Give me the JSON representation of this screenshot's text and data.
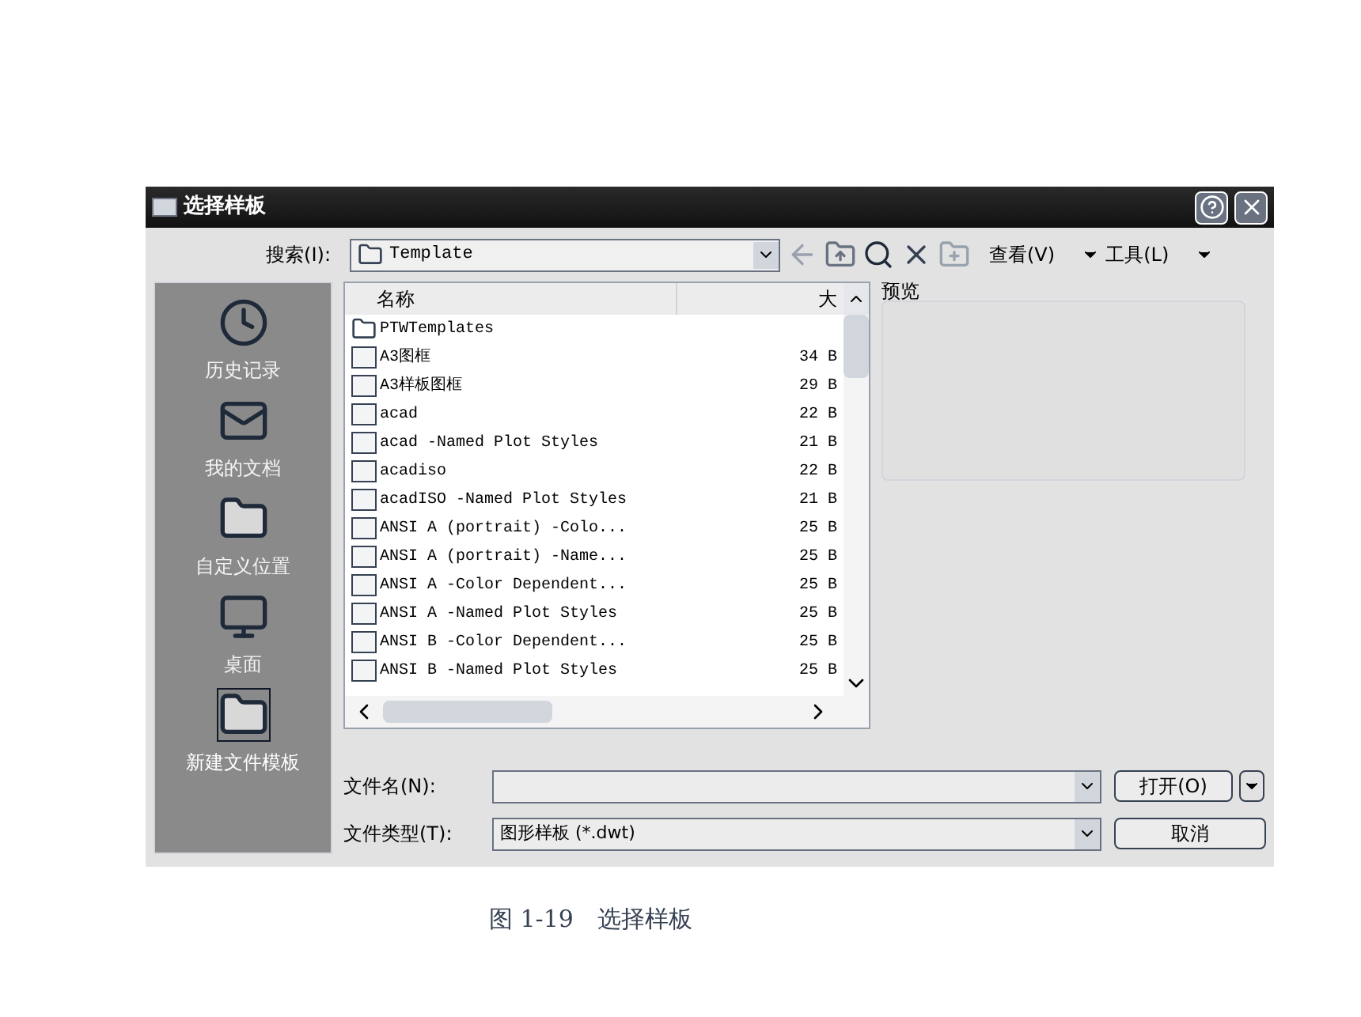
{
  "window": {
    "title": "选择样板"
  },
  "toolbar": {
    "search_label": "搜索(I):",
    "location": "Template",
    "view_menu": "查看(V)",
    "tools_menu": "工具(L)"
  },
  "sidebar": {
    "items": [
      {
        "label": "历史记录",
        "kind": "history",
        "selected": false
      },
      {
        "label": "我的文档",
        "kind": "documents",
        "selected": false
      },
      {
        "label": "自定义位置",
        "kind": "folder",
        "selected": false
      },
      {
        "label": "桌面",
        "kind": "desktop",
        "selected": false
      },
      {
        "label": "新建文件模板",
        "kind": "folder",
        "selected": true
      }
    ]
  },
  "file_list": {
    "columns": [
      "名称",
      "大"
    ],
    "rows": [
      {
        "name": "PTWTemplates",
        "kind": "folder",
        "size": ""
      },
      {
        "name": "A3图框",
        "kind": "dwt",
        "size": "34 B"
      },
      {
        "name": "A3样板图框",
        "kind": "dwt",
        "size": "29 B"
      },
      {
        "name": "acad",
        "kind": "dwt",
        "size": "22 B"
      },
      {
        "name": "acad -Named Plot Styles",
        "kind": "dwt",
        "size": "21 B"
      },
      {
        "name": "acadiso",
        "kind": "dwt",
        "size": "22 B"
      },
      {
        "name": "acadISO -Named Plot Styles",
        "kind": "dwt",
        "size": "21 B"
      },
      {
        "name": "ANSI A (portrait) -Colo...",
        "kind": "dwt",
        "size": "25 B"
      },
      {
        "name": "ANSI A (portrait) -Name...",
        "kind": "dwt",
        "size": "25 B"
      },
      {
        "name": "ANSI A -Color Dependent...",
        "kind": "dwt",
        "size": "25 B"
      },
      {
        "name": "ANSI A -Named Plot Styles",
        "kind": "dwt",
        "size": "25 B"
      },
      {
        "name": "ANSI B -Color Dependent...",
        "kind": "dwt",
        "size": "25 B"
      },
      {
        "name": "ANSI B -Named Plot Styles",
        "kind": "dwt",
        "size": "25 B"
      }
    ]
  },
  "preview": {
    "label": "预览"
  },
  "file_name": {
    "label": "文件名(N):"
  },
  "file_type": {
    "label": "文件类型(T):",
    "value": "图形样板 (*.dwt)"
  },
  "buttons": {
    "open": "打开(O)",
    "cancel": "取消"
  },
  "caption": "图 1-19　选择样板"
}
